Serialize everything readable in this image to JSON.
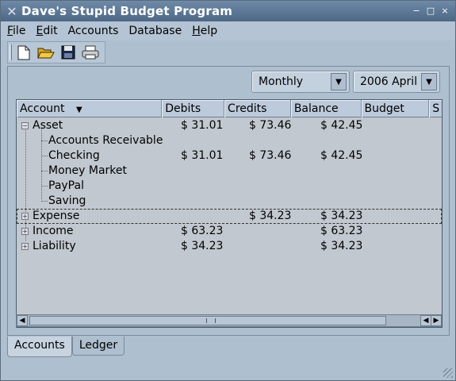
{
  "window": {
    "title": "Dave's Stupid Budget Program",
    "controls": [
      "−",
      "□",
      "×"
    ]
  },
  "menubar": {
    "items": [
      {
        "label": "File",
        "mnemonic": "F"
      },
      {
        "label": "Edit",
        "mnemonic": "E"
      },
      {
        "label": "Accounts",
        "mnemonic": ""
      },
      {
        "label": "Database",
        "mnemonic": ""
      },
      {
        "label": "Help",
        "mnemonic": "H"
      }
    ]
  },
  "toolbar": {
    "buttons": [
      "new-file-icon",
      "open-folder-icon",
      "save-disk-icon",
      "print-icon"
    ]
  },
  "filters": {
    "period": "Monthly",
    "date": "2006 April"
  },
  "tree": {
    "columns": [
      "Account",
      "Debits",
      "Credits",
      "Balance",
      "Budget",
      "S"
    ],
    "sort_indicator": "▼",
    "rows": [
      {
        "account": "Asset",
        "debits": "$ 31.01",
        "credits": "$ 73.46",
        "balance": "$ 42.45",
        "expanded": true,
        "level": 0
      },
      {
        "account": "Accounts Receivable",
        "debits": "",
        "credits": "",
        "balance": "",
        "level": 1
      },
      {
        "account": "Checking",
        "debits": "$ 31.01",
        "credits": "$ 73.46",
        "balance": "$ 42.45",
        "level": 1
      },
      {
        "account": "Money Market",
        "debits": "",
        "credits": "",
        "balance": "",
        "level": 1
      },
      {
        "account": "PayPal",
        "debits": "",
        "credits": "",
        "balance": "",
        "level": 1
      },
      {
        "account": "Saving",
        "debits": "",
        "credits": "",
        "balance": "",
        "level": 1
      },
      {
        "account": "Expense",
        "debits": "",
        "credits": "$ 34.23",
        "balance": "$ 34.23",
        "expanded": false,
        "level": 0,
        "selected": true
      },
      {
        "account": "Income",
        "debits": "$ 63.23",
        "credits": "",
        "balance": "$ 63.23",
        "expanded": false,
        "level": 0
      },
      {
        "account": "Liability",
        "debits": "$ 34.23",
        "credits": "",
        "balance": "$ 34.23",
        "expanded": false,
        "level": 0
      }
    ]
  },
  "tabs": [
    {
      "label": "Accounts",
      "active": true
    },
    {
      "label": "Ledger",
      "active": false
    }
  ]
}
